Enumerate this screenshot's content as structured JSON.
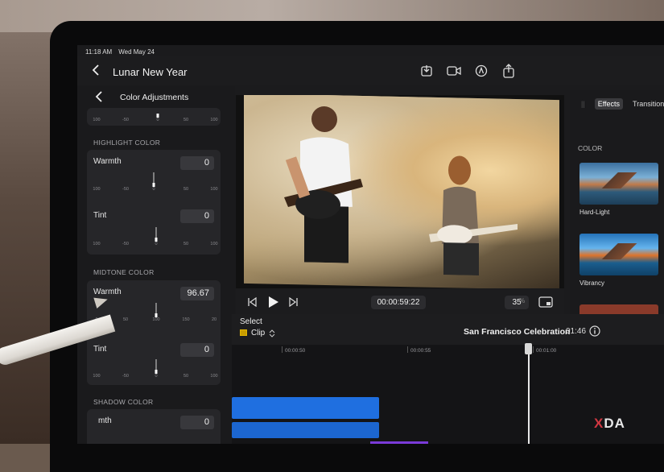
{
  "status": {
    "time": "11:18 AM",
    "date": "Wed May 24"
  },
  "project": {
    "title": "Lunar New Year"
  },
  "inspector": {
    "title": "Color Adjustments",
    "highlight": {
      "label": "HIGHLIGHT COLOR",
      "warmth": {
        "label": "Warmth",
        "value": "0",
        "ticks": [
          "100",
          "-50",
          "0",
          "50",
          "100"
        ]
      },
      "tint": {
        "label": "Tint",
        "value": "0",
        "ticks": [
          "100",
          "-50",
          "0",
          "50",
          "100"
        ]
      }
    },
    "midtone": {
      "label": "MIDTONE COLOR",
      "warmth": {
        "label": "Warmth",
        "value": "96.67",
        "ticks": [
          "0",
          "50",
          "100",
          "150",
          "20"
        ]
      },
      "tint": {
        "label": "Tint",
        "value": "0",
        "ticks": [
          "100",
          "-50",
          "0",
          "50",
          "100"
        ]
      }
    },
    "shadow": {
      "label": "SHADOW COLOR",
      "warmth": {
        "label": "mth",
        "value": "0"
      }
    },
    "top_ticks": [
      "100",
      "-50",
      "0",
      "50",
      "100"
    ]
  },
  "viewer": {
    "timecode": "00:00:59:22",
    "zoom": "35",
    "zoom_unit": "%"
  },
  "library": {
    "tabs": [
      "Effects",
      "Transitions"
    ],
    "active_tab": "Effects",
    "section": "COLOR",
    "effects": [
      "Hard-Light",
      "Vibrancy"
    ]
  },
  "timeline": {
    "select_label": "Select",
    "clip_label": "Clip",
    "project_name": "San Francisco Celebration",
    "duration": "01:46",
    "ruler": [
      "00:00:50",
      "00:00:55",
      "00:01:00"
    ]
  },
  "watermark": {
    "x": "X",
    "rest": "DA"
  },
  "colors": {
    "accent_blue": "#1f6fe0",
    "clip_yellow": "#c89c00"
  }
}
